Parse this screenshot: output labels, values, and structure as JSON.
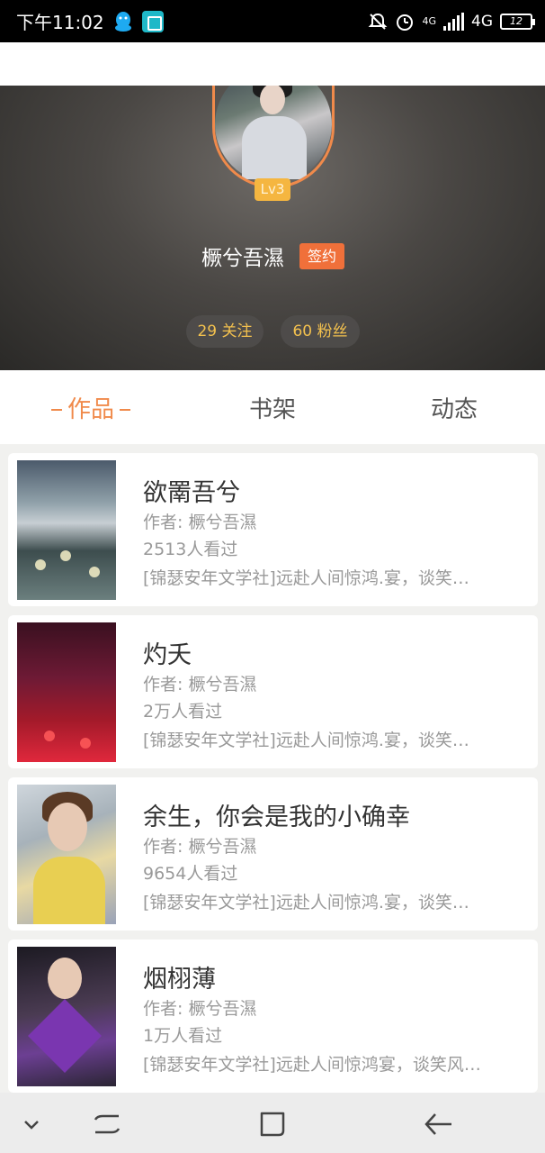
{
  "status_bar": {
    "time": "下午11:02",
    "network_small": "4G",
    "network": "4G",
    "battery": "12"
  },
  "profile": {
    "level": "Lv3",
    "username": "橛兮吾濕",
    "badge": "签约",
    "following": "29 关注",
    "followers": "60 粉丝"
  },
  "tabs": [
    {
      "label": "作品",
      "active": true
    },
    {
      "label": "书架",
      "active": false
    },
    {
      "label": "动态",
      "active": false
    }
  ],
  "books": [
    {
      "title": "欲罱吾兮",
      "author": "作者: 橛兮吾濕",
      "views": "2513人看过",
      "desc": "[锦瑟安年文学社]远赴人间惊鸿.宴，谈笑…"
    },
    {
      "title": "灼夭",
      "author": "作者: 橛兮吾濕",
      "views": "2万人看过",
      "desc": "[锦瑟安年文学社]远赴人间惊鸿.宴，谈笑…"
    },
    {
      "title": "余生，你会是我的小确幸",
      "author": "作者: 橛兮吾濕",
      "views": "9654人看过",
      "desc": "[锦瑟安年文学社]远赴人间惊鸿.宴，谈笑…"
    },
    {
      "title": "烟栩薄",
      "author": "作者: 橛兮吾濕",
      "views": "1万人看过",
      "desc": "[锦瑟安年文学社]远赴人间惊鸿宴，谈笑风…"
    }
  ],
  "colors": {
    "accent": "#f08a4b",
    "sign_badge": "#f0703a",
    "level_badge": "#f5b640",
    "stat_text": "#f3c14e"
  }
}
